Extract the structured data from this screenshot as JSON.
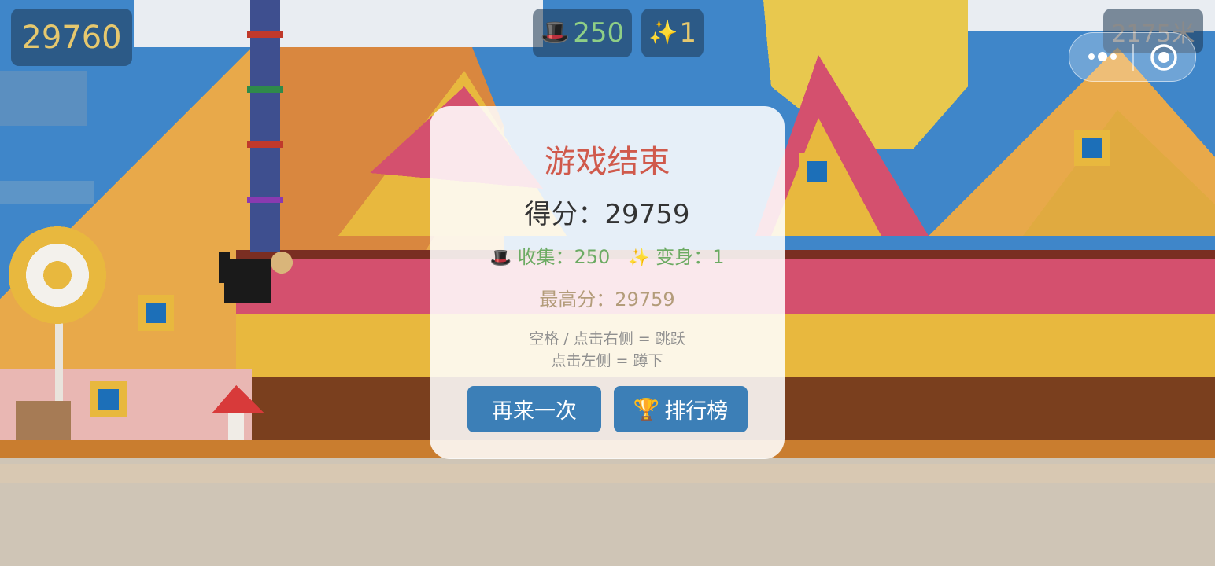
{
  "hud": {
    "score": "29760",
    "hats_icon": "🎩",
    "hats": "250",
    "transform_icon": "✨",
    "transforms": "1",
    "distance": "2175米"
  },
  "capsule": {
    "menu_icon": "more-dots-icon",
    "close_icon": "target-close-icon"
  },
  "dialog": {
    "title": "游戏结束",
    "score_text": "得分：29759",
    "hat_icon": "🎩",
    "collect_text": "收集：250",
    "transform_icon": "✨",
    "transform_text": "变身：1",
    "best_text": "最高分：29759",
    "hint_line1": "空格 / 点击右侧 = 跳跃",
    "hint_line2": "点击左侧 = 蹲下",
    "retry_label": "再来一次",
    "rank_icon": "🏆",
    "rank_label": "排行榜"
  },
  "colors": {
    "sky": "#3f86c9",
    "sand": "#e8a94a",
    "pink": "#d4506e",
    "yellow": "#e8b83e",
    "ground": "#cfc5b6",
    "button": "#3c7fb7",
    "title": "#d05a4c"
  }
}
